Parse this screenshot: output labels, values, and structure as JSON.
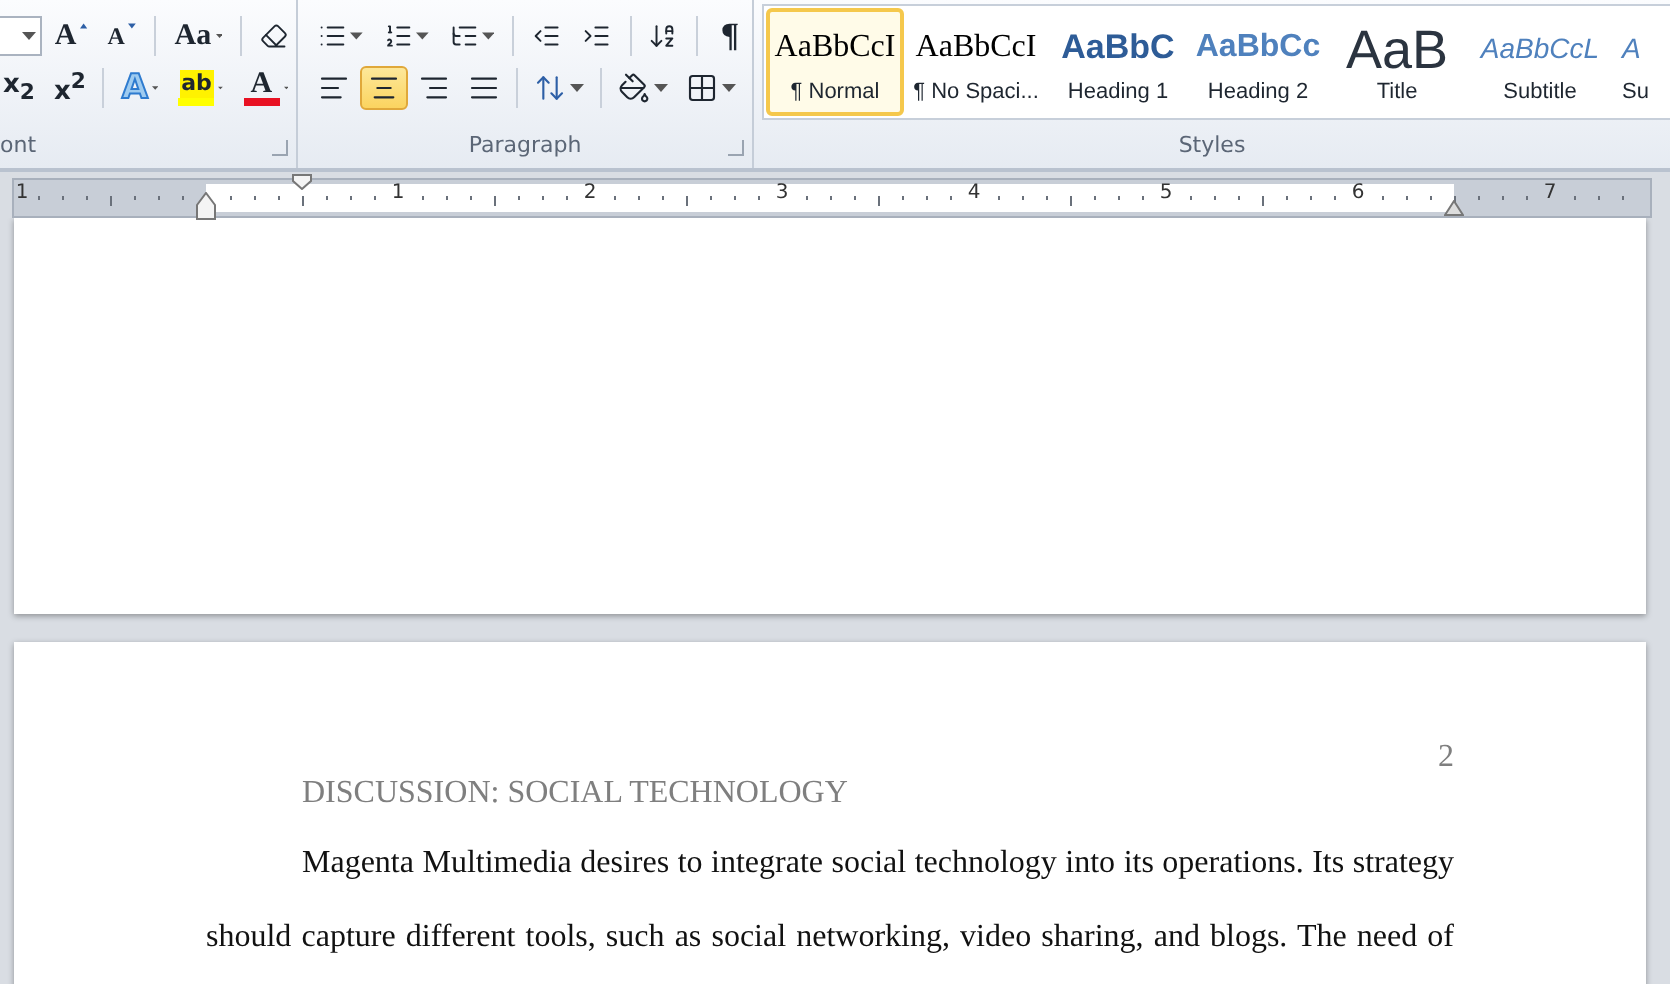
{
  "ribbon": {
    "font_group": {
      "label": "ont",
      "grow_font": "A",
      "shrink_font": "A",
      "change_case": "Aa",
      "subscript": "x$_{2}$",
      "superscript": "x$^{2}$",
      "text_effects": "A",
      "highlight": "ab",
      "font_color": "A"
    },
    "paragraph_group": {
      "label": "Paragraph",
      "pilcrow": "¶",
      "alignment": [
        {
          "kind": "left",
          "selected": false
        },
        {
          "kind": "center",
          "selected": true
        },
        {
          "kind": "right",
          "selected": false
        },
        {
          "kind": "justify",
          "selected": false
        }
      ]
    },
    "styles_group": {
      "label": "Styles",
      "items": [
        {
          "kind": "normal",
          "preview": "AaBbCcI",
          "label": "¶ Normal",
          "selected": true
        },
        {
          "kind": "normal",
          "preview": "AaBbCcI",
          "label": "¶ No Spaci...",
          "selected": false
        },
        {
          "kind": "heading1",
          "preview": "AaBbC",
          "label": "Heading 1",
          "selected": false
        },
        {
          "kind": "heading2",
          "preview": "AaBbCc",
          "label": "Heading 2",
          "selected": false
        },
        {
          "kind": "title",
          "preview": "AaB",
          "label": "Title",
          "selected": false
        },
        {
          "kind": "subtitle",
          "preview": "AaBbCcL",
          "label": "Subtitle",
          "selected": false
        },
        {
          "kind": "subtitle",
          "preview": "A",
          "label": "Su",
          "selected": false
        }
      ]
    }
  },
  "ruler": {
    "numbers": [
      "1",
      "1",
      "2",
      "3",
      "4",
      "5",
      "6",
      "7"
    ]
  },
  "document": {
    "page_number": "2",
    "heading": "DISCUSSION: SOCIAL TECHNOLOGY",
    "paragraph": "Magenta Multimedia desires to integrate social technology into its operations. Its strategy should capture different tools, such as social networking, video sharing, and blogs. The need of"
  }
}
